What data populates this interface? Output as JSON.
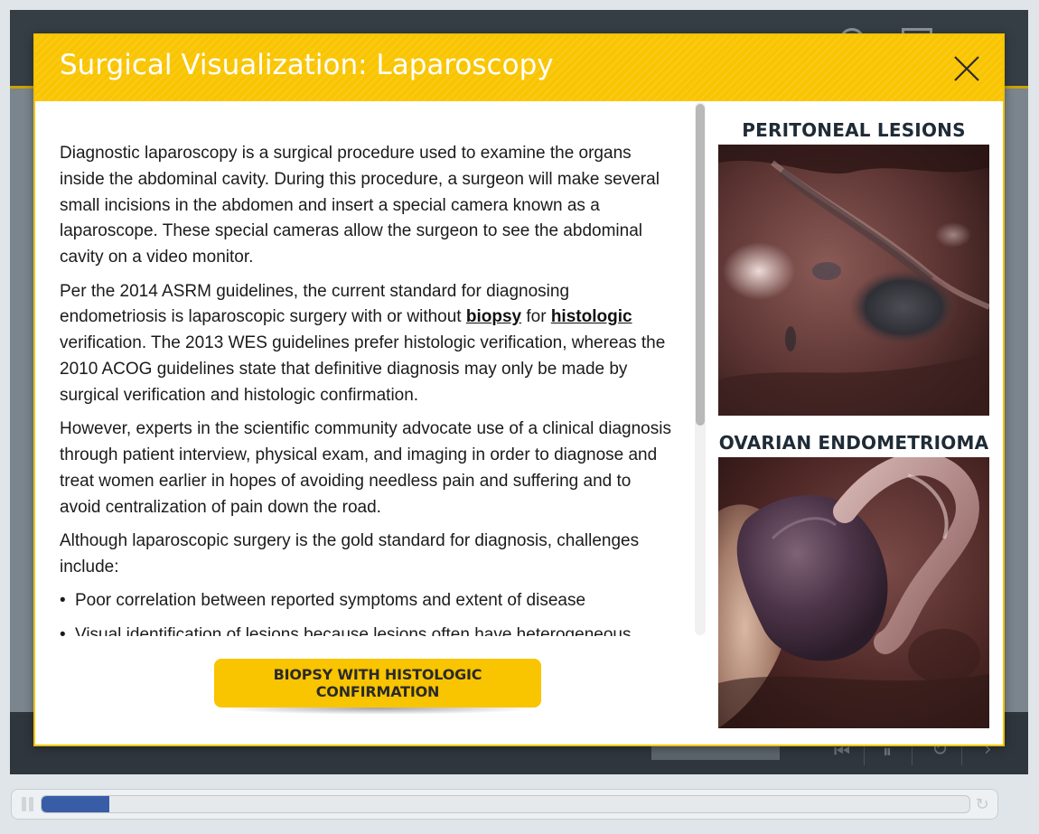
{
  "modal": {
    "title": "Surgical Visualization: Laparoscopy",
    "close_label": "×"
  },
  "content": {
    "p1": "Diagnostic laparoscopy is a surgical procedure used to examine the organs inside the abdominal cavity. During this procedure, a surgeon will make several small incisions in the abdomen and insert a special camera known as a laparoscope. These special cameras allow the surgeon to see the abdominal cavity on a video monitor.",
    "p2_before": "Per the 2014 ASRM guidelines, the current standard for diagnosing endometriosis is laparoscopic surgery with or without ",
    "p2_link1": "biopsy",
    "p2_mid": " for ",
    "p2_link2": "histologic",
    "p2_after": " verification. The 2013 WES guidelines prefer histologic verification, whereas the 2010 ACOG guidelines state that definitive diagnosis may only be made by surgical verification and histologic confirmation.",
    "p3": "However, experts in the scientific community advocate use of a clinical diagnosis through patient interview, physical exam, and imaging in order to diagnose and treat women earlier in hopes of avoiding needless pain and suffering and to avoid centralization of pain down the road.",
    "p4": "Although laparoscopic surgery is the gold standard for diagnosis, challenges include:",
    "bullet_char": "•",
    "bullets": [
      "Poor correlation between reported symptoms and extent of disease",
      "Visual identification of lesions because lesions often have heterogeneous"
    ]
  },
  "cta": {
    "label": "BIOPSY WITH HISTOLOGIC CONFIRMATION"
  },
  "panel": {
    "heading1": "PERITONEAL LESIONS",
    "heading2": "OVARIAN ENDOMETRIOMA"
  },
  "player": {
    "progress_fraction": 0.073,
    "icons": [
      "search-icon",
      "save-icon",
      "rewind-icon",
      "pause-icon",
      "replay-icon",
      "forward-icon"
    ]
  },
  "colors": {
    "accent": "#f9c400",
    "progress": "#385da6",
    "shell_dark": "#353d45"
  }
}
